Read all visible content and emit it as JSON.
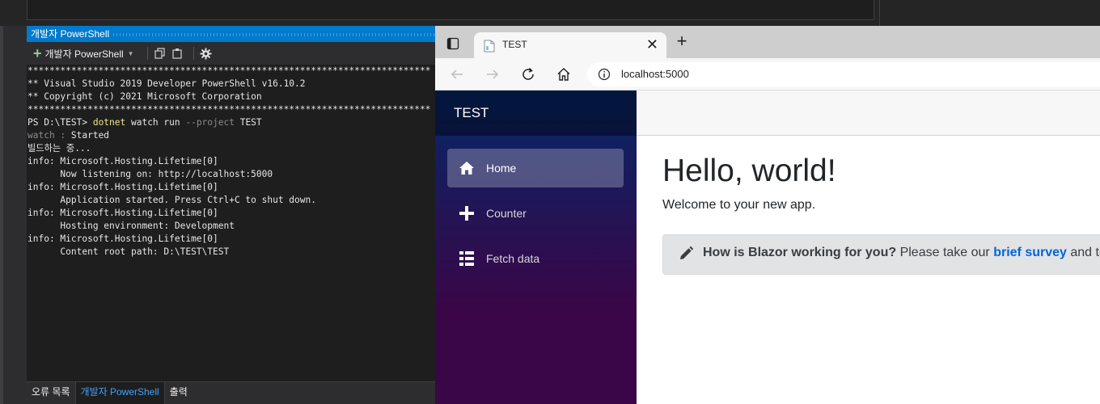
{
  "powershell": {
    "window_title": "개발자 PowerShell",
    "toolbar": {
      "new_terminal_label": "개발자 PowerShell"
    },
    "console_lines": [
      {
        "text": "**************************************************************************",
        "style": "normal"
      },
      {
        "text": "** Visual Studio 2019 Developer PowerShell v16.10.2",
        "style": "normal"
      },
      {
        "text": "** Copyright (c) 2021 Microsoft Corporation",
        "style": "normal"
      },
      {
        "text": "**************************************************************************",
        "style": "normal"
      },
      {
        "text": "PS D:\\TEST> ",
        "style": "prompt",
        "cmd": "dotnet",
        "rest": " watch run ",
        "arg": "--project",
        "tail": " TEST"
      },
      {
        "text": "watch : ",
        "style": "watch",
        "rest": "Started"
      },
      {
        "text": "빌드하는 중...",
        "style": "normal"
      },
      {
        "text": "info: Microsoft.Hosting.Lifetime[0]",
        "style": "normal"
      },
      {
        "text": "      Now listening on: http://localhost:5000",
        "style": "normal"
      },
      {
        "text": "info: Microsoft.Hosting.Lifetime[0]",
        "style": "normal"
      },
      {
        "text": "      Application started. Press Ctrl+C to shut down.",
        "style": "normal"
      },
      {
        "text": "info: Microsoft.Hosting.Lifetime[0]",
        "style": "normal"
      },
      {
        "text": "      Hosting environment: Development",
        "style": "normal"
      },
      {
        "text": "info: Microsoft.Hosting.Lifetime[0]",
        "style": "normal"
      },
      {
        "text": "      Content root path: D:\\TEST\\TEST",
        "style": "normal"
      }
    ],
    "bottom_tabs": [
      {
        "label": "오류 목록",
        "active": false
      },
      {
        "label": "개발자 PowerShell",
        "active": true
      },
      {
        "label": "출력",
        "active": false
      }
    ]
  },
  "browser": {
    "tab_title": "TEST",
    "address": "localhost:5000",
    "icons": [
      "tab-actions-icon",
      "page-favicon-icon",
      "close-icon",
      "plus-icon",
      "back-icon",
      "forward-icon",
      "refresh-icon",
      "home-icon",
      "info-icon"
    ]
  },
  "app": {
    "brand": "TEST",
    "nav": [
      {
        "label": "Home",
        "icon": "home-icon",
        "active": true
      },
      {
        "label": "Counter",
        "icon": "plus-icon",
        "active": false
      },
      {
        "label": "Fetch data",
        "icon": "list-icon",
        "active": false
      }
    ],
    "heading": "Hello, world!",
    "welcome": "Welcome to your new app.",
    "survey": {
      "question": "How is Blazor working for you?",
      "lead": " Please take our ",
      "link": "brief survey",
      "trail": " and te"
    }
  },
  "colors": {
    "vs_accent": "#007acc",
    "console_bg": "#1e1e1e",
    "command_yellow": "#f0e68c",
    "sidebar_top": "#052767",
    "sidebar_bottom": "#3a0647",
    "link_blue": "#0366d6"
  }
}
